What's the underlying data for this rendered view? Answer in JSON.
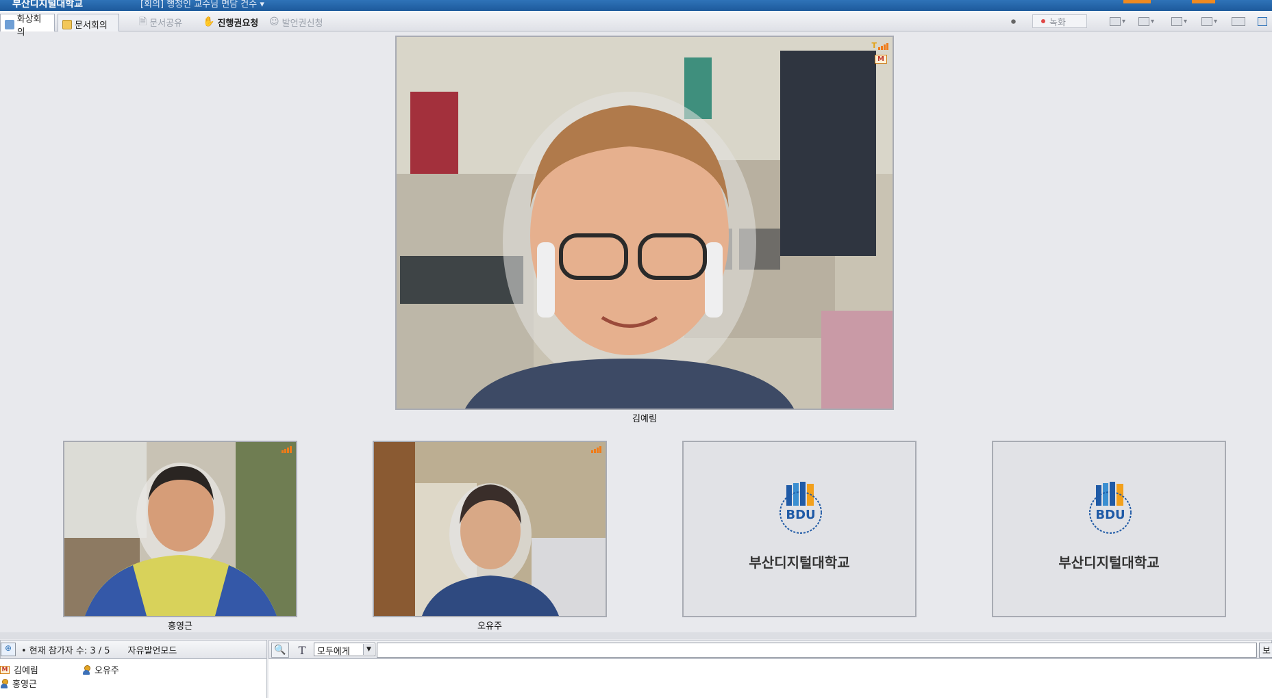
{
  "titlebar": {
    "app_name": "부산디지털대학교",
    "meeting_title": "[회의] 행정인 교수님 면담 건수 ▾"
  },
  "toolbar": {
    "tabs": [
      {
        "label": "화상회의",
        "active": true
      },
      {
        "label": "문서회의",
        "active": false
      }
    ],
    "doc_share": "문서공유",
    "request_control": "진행권요청",
    "request_speak": "발언권신청",
    "record": "녹화"
  },
  "main_video": {
    "name": "김예림",
    "mic_badge": "M",
    "signal_label": "T"
  },
  "videos": [
    {
      "name": "홍영근"
    },
    {
      "name": "오유주"
    }
  ],
  "empty_tiles": [
    {
      "logo_abbr": "BDU",
      "logo_text": "부산디지털대학교"
    },
    {
      "logo_abbr": "BDU",
      "logo_text": "부산디지털대학교"
    }
  ],
  "participants_panel": {
    "count_label": "• 현재 참가자 수: 3 / 5",
    "mode_label": "자유발언모드",
    "items": [
      {
        "name": "김예림",
        "badge": "M"
      },
      {
        "name": "오유주",
        "badge": "person"
      },
      {
        "name": "홍영근",
        "badge": "person"
      }
    ]
  },
  "chat": {
    "recipient": "모두에게",
    "send_label": "보"
  },
  "colors": {
    "titlebar": "#2f73b8",
    "record_dot": "#e04848",
    "badge_orange": "#f07b18",
    "logo_blue": "#1f5aa6",
    "logo_orange": "#f2a01c"
  }
}
